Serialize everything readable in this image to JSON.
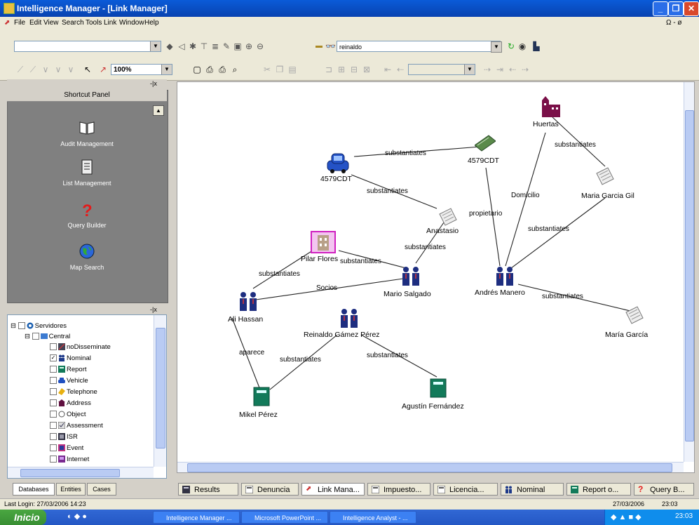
{
  "window": {
    "title": "Intelligence Manager - [Link Manager]",
    "min": "_",
    "max": "❐",
    "close": "✕"
  },
  "menu": [
    "File",
    "Edit",
    "View",
    "Search",
    "Tools",
    "Link",
    "Window",
    "Help"
  ],
  "menu_right": "Ω - ø",
  "toolbar": {
    "search_value": "reinaldo",
    "zoom": "100%"
  },
  "shortcut_panel": {
    "title": "Shortcut Panel",
    "items": [
      "Audit Management",
      "List Management",
      "Query Builder",
      "Map Search"
    ]
  },
  "tree": {
    "root": "Servidores",
    "central": "Central",
    "items": [
      "noDisseminate",
      "Nominal",
      "Report",
      "Vehicle",
      "Telephone",
      "Address",
      "Object",
      "Assessment",
      "ISR",
      "Event",
      "Internet"
    ]
  },
  "left_tabs": [
    "Databases",
    "Entities",
    "Cases"
  ],
  "graph": {
    "nodes": [
      "Huertas",
      "4579CDT",
      "4579CDT",
      "Maria Garcia Gil",
      "Anastasio",
      "Pilar Flores",
      "Mario Salgado",
      "Andrés Manero",
      "Ali Hassan",
      "Reinaldo Gámez Pérez",
      "María García",
      "Mikel Pérez",
      "Agustín Fernández"
    ],
    "edge_labels": [
      "substantiates",
      "substantiates",
      "substantiates",
      "Domicilio",
      "propietario",
      "substantiates",
      "substantiates",
      "substantiates",
      "substantiates",
      "Socios",
      "substantiates",
      "aparece",
      "substantiates",
      "substantiates"
    ]
  },
  "bottom_tabs": [
    "Results",
    "Denuncia",
    "Link Mana...",
    "Impuesto...",
    "Licencia...",
    "Nominal",
    "Report o...",
    "Query B..."
  ],
  "status": {
    "left": "Last Login: 27/03/2006 14:23",
    "date": "27/03/2006",
    "time": "23:03"
  },
  "taskbar": {
    "start": "Inicio",
    "tasks": [
      "Intelligence Manager ...",
      "Microsoft PowerPoint ...",
      "Intelligence Analyst - ..."
    ],
    "clock": "23:03"
  }
}
